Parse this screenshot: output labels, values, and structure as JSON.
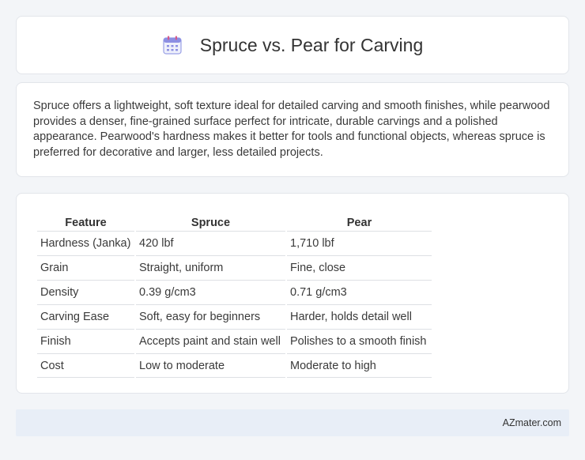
{
  "header": {
    "title": "Spruce vs. Pear for Carving",
    "icon": "calendar-icon"
  },
  "summary": {
    "text": "Spruce offers a lightweight, soft texture ideal for detailed carving and smooth finishes, while pearwood provides a denser, fine-grained surface perfect for intricate, durable carvings and a polished appearance. Pearwood's hardness makes it better for tools and functional objects, whereas spruce is preferred for decorative and larger, less detailed projects."
  },
  "table": {
    "headers": [
      "Feature",
      "Spruce",
      "Pear"
    ],
    "rows": [
      [
        "Hardness (Janka)",
        "420 lbf",
        "1,710 lbf"
      ],
      [
        "Grain",
        "Straight, uniform",
        "Fine, close"
      ],
      [
        "Density",
        "0.39 g/cm3",
        "0.71 g/cm3"
      ],
      [
        "Carving Ease",
        "Soft, easy for beginners",
        "Harder, holds detail well"
      ],
      [
        "Finish",
        "Accepts paint and stain well",
        "Polishes to a smooth finish"
      ],
      [
        "Cost",
        "Low to moderate",
        "Moderate to high"
      ]
    ]
  },
  "footer": {
    "brand": "AZmater.com"
  },
  "colors": {
    "background": "#f3f5f8",
    "card": "#ffffff",
    "footer": "#e8eef7",
    "icon_accent": "#7b7fe0"
  }
}
